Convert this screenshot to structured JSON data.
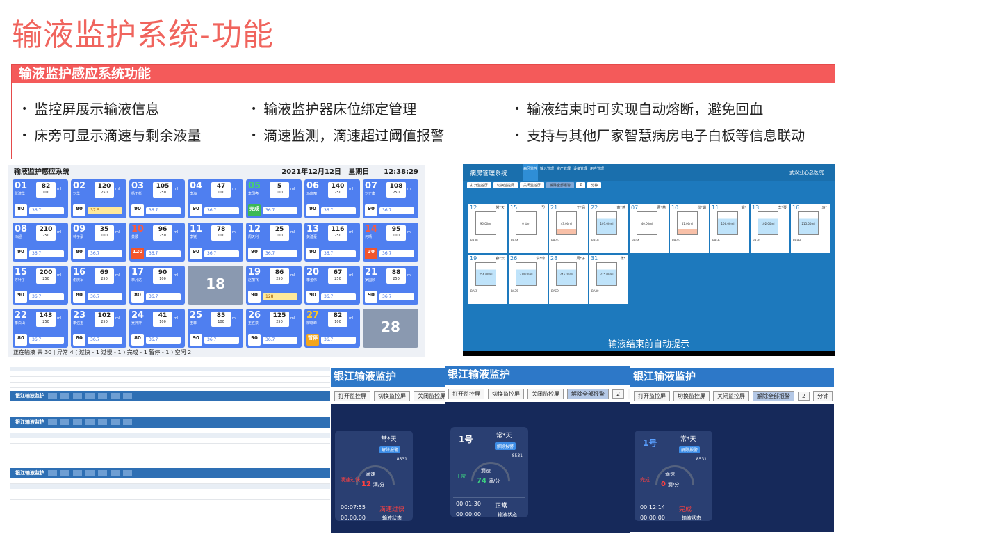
{
  "title": "输液监护系统-功能",
  "features": {
    "heading": "输液监护感应系统功能",
    "items": [
      "监控屏展示输液信息",
      "输液监护器床位绑定管理",
      "输液结束时可实现自动熔断，避免回血",
      "床旁可显示滴速与剩余液量",
      "滴速监测，滴速超过阈值报警",
      "支持与其他厂家智慧病房电子白板等信息联动"
    ]
  },
  "monitor1": {
    "title": "输液监护感应系统",
    "date": "2021年12月12日",
    "weekday": "星期日",
    "time": "12:38:29",
    "beds": [
      {
        "no": "01",
        "name": "张建华",
        "vol": "82",
        "total": "100",
        "speed": "80",
        "temp": "36.7"
      },
      {
        "no": "02",
        "name": "刘华",
        "vol": "120",
        "total": "250",
        "speed": "80",
        "temp": "37.5",
        "hl": true
      },
      {
        "no": "03",
        "name": "杨丁杉",
        "vol": "105",
        "total": "250",
        "speed": "90",
        "temp": "36.7"
      },
      {
        "no": "04",
        "name": "李海",
        "vol": "47",
        "total": "100",
        "speed": "90",
        "temp": "36.7"
      },
      {
        "no": "05",
        "name": "李国亮",
        "vol": "5",
        "total": "100",
        "speed": "完成",
        "temp": "36.7",
        "st": "ok"
      },
      {
        "no": "06",
        "name": "马晓丽",
        "vol": "140",
        "total": "250",
        "speed": "90",
        "temp": "36.7"
      },
      {
        "no": "07",
        "name": "刘正康",
        "vol": "108",
        "total": "250",
        "speed": "90",
        "temp": "36.7"
      },
      {
        "no": "08",
        "name": "冯超",
        "vol": "210",
        "total": "250",
        "speed": "90",
        "temp": "36.7"
      },
      {
        "no": "09",
        "name": "林子豪",
        "vol": "35",
        "total": "100",
        "speed": "80",
        "temp": "36.7"
      },
      {
        "no": "10",
        "name": "黄顺",
        "vol": "96",
        "total": "250",
        "speed": "120",
        "temp": "36.7",
        "st": "warn"
      },
      {
        "no": "11",
        "name": "李锐",
        "vol": "78",
        "total": "100",
        "speed": "90",
        "temp": "36.7"
      },
      {
        "no": "12",
        "name": "周天利",
        "vol": "25",
        "total": "100",
        "speed": "90",
        "temp": "36.7"
      },
      {
        "no": "13",
        "name": "黄建豪",
        "vol": "116",
        "total": "250",
        "speed": "90",
        "temp": "36.7"
      },
      {
        "no": "14",
        "name": "何晴",
        "vol": "95",
        "total": "100",
        "speed": "30",
        "temp": "36.7",
        "st": "warn"
      },
      {
        "no": "15",
        "name": "方叶子",
        "vol": "200",
        "total": "250",
        "speed": "90",
        "temp": "36.7"
      },
      {
        "no": "16",
        "name": "谢庆军",
        "vol": "69",
        "total": "250",
        "speed": "80",
        "temp": "36.7"
      },
      {
        "no": "17",
        "name": "李凡达",
        "vol": "90",
        "total": "100",
        "speed": "80",
        "temp": "36.7"
      },
      {
        "no": "18",
        "empty": true
      },
      {
        "no": "19",
        "name": "赵丽飞",
        "vol": "86",
        "total": "250",
        "speed": "90",
        "temp": "128",
        "hl": true
      },
      {
        "no": "20",
        "name": "李金伟",
        "vol": "67",
        "total": "250",
        "speed": "90",
        "temp": "36.7"
      },
      {
        "no": "21",
        "name": "罗国欣",
        "vol": "88",
        "total": "250",
        "speed": "90",
        "temp": "36.7"
      },
      {
        "no": "22",
        "name": "李白山",
        "vol": "143",
        "total": "250",
        "speed": "80",
        "temp": "36.7"
      },
      {
        "no": "23",
        "name": "李强玉",
        "vol": "102",
        "total": "250",
        "speed": "80",
        "temp": "36.7"
      },
      {
        "no": "24",
        "name": "吴萍萍",
        "vol": "41",
        "total": "100",
        "speed": "80",
        "temp": "36.7"
      },
      {
        "no": "25",
        "name": "王菲",
        "vol": "85",
        "total": "100",
        "speed": "90",
        "temp": "36.7"
      },
      {
        "no": "26",
        "name": "王胜泉",
        "vol": "125",
        "total": "250",
        "speed": "90",
        "temp": "36.7"
      },
      {
        "no": "27",
        "name": "柳晓峰",
        "vol": "82",
        "total": "100",
        "speed": "暂停",
        "temp": "36.7",
        "st": "yel"
      },
      {
        "no": "28",
        "empty": true
      }
    ],
    "footer": "正在输液 共 30 | 异常 4 ( 过快 - 1    过慢 - 1 )    完成 - 1    暂停 - 1 )        空闲 2"
  },
  "monitor2": {
    "system": "病房管理系统",
    "nav": [
      "病区监控",
      "输入管理",
      "资产管理",
      "设备管理",
      "用户管理"
    ],
    "logo": "武汉亚心总医院",
    "buttons": [
      "打开监控屏",
      "切换监控屏",
      "关闭监控屏",
      "解除全部报警",
      "2",
      "分钟"
    ],
    "cards": [
      {
        "no": "12",
        "code": "BA30",
        "type": "常*天",
        "vol": "96.00ml"
      },
      {
        "no": "15",
        "code": "BA44",
        "type": "(*)",
        "vol": "0 d/m"
      },
      {
        "no": "21",
        "code": "BA26",
        "type": "于*涵",
        "vol": "43.00ml",
        "pink": true
      },
      {
        "no": "22",
        "code": "BAE0",
        "type": "高*燕",
        "vol": "107.00ml",
        "blue": true
      },
      {
        "no": "07",
        "code": "BA04",
        "type": "曹*燕",
        "vol": "40.00ml"
      },
      {
        "no": "10",
        "code": "BA26",
        "type": "张*娟",
        "vol": "51.00ml",
        "pink": true
      },
      {
        "no": "11",
        "code": "BAE6",
        "type": "胡*",
        "vol": "106.00ml",
        "blue": true
      },
      {
        "no": "13",
        "code": "BA70",
        "type": "李*琴",
        "vol": "102.00ml",
        "blue": true
      },
      {
        "no": "16",
        "code": "BAB9",
        "type": "马*",
        "vol": "215.00ml",
        "blue": true
      },
      {
        "no": "19",
        "code": "BAEF",
        "type": "薛*云",
        "vol": "256.00ml",
        "blue": true
      },
      {
        "no": "26",
        "code": "BA79",
        "type": "洪*琼",
        "vol": "270.00ml",
        "blue": true
      },
      {
        "no": "28",
        "code": "BAC9",
        "type": "周*子",
        "vol": "245.00ml",
        "blue": true
      },
      {
        "no": "31",
        "code": "BA30",
        "type": "张*",
        "vol": "225.00ml",
        "blue": true
      }
    ],
    "caption": "输液结束前自动提示"
  },
  "dark": {
    "title": "银江输液监护",
    "btns": [
      "打开监控屏",
      "切换监控屏",
      "关闭监控屏",
      "解除全部报警",
      "2",
      "分钟"
    ],
    "release": "解除报警",
    "code": "8531",
    "speed_label": "滴速",
    "unit": "滴/分",
    "status_label": "输液状态",
    "cards": [
      {
        "num": "",
        "type": "常*天",
        "state": "滴速过快",
        "rate": "12",
        "t1": "00:07:55",
        "t2": "00:00:00",
        "res": "滴速过快",
        "color": "#ff4040"
      },
      {
        "num": "1号",
        "type": "常*天",
        "state": "正常",
        "rate": "74",
        "t1": "00:01:30",
        "t2": "00:00:00",
        "res": "正常",
        "color": "#3cd080"
      },
      {
        "num": "1号",
        "type": "常*天",
        "state": "完成",
        "rate": "0",
        "t1": "00:12:14",
        "t2": "00:00:00",
        "res": "完成",
        "color": "#ff4040"
      }
    ]
  },
  "mini": {
    "title": "银江输液监护",
    "tabs": [
      "监控管理",
      "数据管理",
      "资产管理",
      "病人管理",
      "数据分析",
      "用户管理",
      "系统管理"
    ]
  }
}
